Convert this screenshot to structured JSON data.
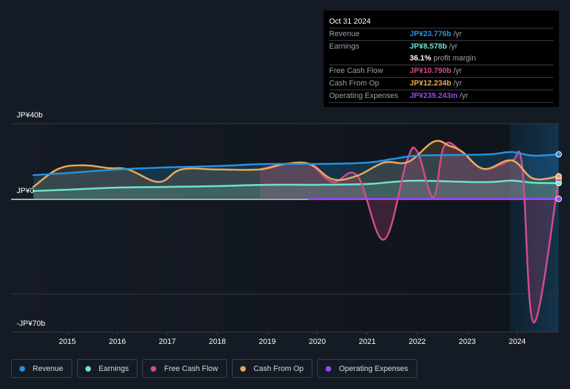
{
  "chart_data": {
    "type": "line",
    "title": "",
    "xlabel": "",
    "ylabel": "",
    "x_range": [
      2014.32,
      2024.83
    ],
    "ylim": [
      -70,
      40
    ],
    "y_unit": "JP¥ billions",
    "y_tick_labels": [
      {
        "value": 40,
        "label": "JP¥40b"
      },
      {
        "value": 0,
        "label": "JP¥0"
      },
      {
        "value": -70,
        "label": "-JP¥70b"
      }
    ],
    "y_gridlines": [
      40,
      0,
      -50
    ],
    "x_ticks": [
      2015,
      2016,
      2017,
      2018,
      2019,
      2020,
      2021,
      2022,
      2023,
      2024
    ],
    "x_tick_labels": [
      "2015",
      "2016",
      "2017",
      "2018",
      "2019",
      "2020",
      "2021",
      "2022",
      "2023",
      "2024"
    ],
    "highlight_range": [
      2023.85,
      2024.83
    ],
    "legend_position": "bottom-left",
    "series": [
      {
        "name": "Revenue",
        "color": "#2394df",
        "x": [
          2014.32,
          2015.0,
          2016.0,
          2017.0,
          2018.0,
          2019.0,
          2020.0,
          2021.0,
          2021.5,
          2022.0,
          2023.0,
          2023.5,
          2023.9,
          2024.32,
          2024.83
        ],
        "y": [
          12.8,
          13.9,
          15.8,
          16.9,
          17.6,
          18.7,
          18.7,
          19.4,
          21.3,
          23.1,
          23.5,
          23.9,
          25.0,
          23.1,
          23.8
        ]
      },
      {
        "name": "Earnings",
        "color": "#6ce5c8",
        "x": [
          2014.32,
          2015.0,
          2016.0,
          2017.0,
          2018.0,
          2019.0,
          2020.0,
          2021.0,
          2021.5,
          2022.0,
          2023.0,
          2023.5,
          2023.9,
          2024.32,
          2024.83
        ],
        "y": [
          4.4,
          5.1,
          6.2,
          6.6,
          7.0,
          7.7,
          7.7,
          8.1,
          9.2,
          9.9,
          9.2,
          9.2,
          9.9,
          8.8,
          8.6
        ]
      },
      {
        "name": "Free Cash Flow",
        "color": "#d04d8b",
        "x": [
          2018.85,
          2019.35,
          2019.85,
          2020.31,
          2020.8,
          2021.33,
          2021.79,
          2022.0,
          2022.32,
          2022.54,
          2022.89,
          2023.33,
          2023.89,
          2024.1,
          2024.33,
          2024.83
        ],
        "y": [
          15.8,
          18.7,
          18.3,
          9.2,
          12.5,
          -21.3,
          20.2,
          25.3,
          1.1,
          28.3,
          25.3,
          16.1,
          20.6,
          17.5,
          -65.0,
          10.79
        ]
      },
      {
        "name": "Cash From Op",
        "color": "#e8a95a",
        "x": [
          2014.32,
          2014.82,
          2015.32,
          2015.83,
          2016.22,
          2016.83,
          2017.28,
          2018.0,
          2018.85,
          2019.35,
          2019.85,
          2020.31,
          2020.8,
          2021.33,
          2021.82,
          2022.33,
          2022.64,
          2022.89,
          2023.33,
          2023.89,
          2024.32,
          2024.83
        ],
        "y": [
          6.6,
          16.1,
          18.0,
          16.5,
          15.8,
          9.2,
          15.8,
          15.8,
          15.8,
          18.7,
          18.7,
          10.6,
          12.5,
          19.4,
          19.8,
          30.5,
          28.3,
          25.3,
          16.1,
          20.6,
          11.0,
          12.234
        ]
      },
      {
        "name": "Operating Expenses",
        "color": "#9b46e8",
        "x": [
          2019.83,
          2020.5,
          2021.5,
          2022.5,
          2023.5,
          2024.83
        ],
        "y": [
          0.24,
          0.24,
          0.24,
          0.24,
          0.24,
          0.239
        ]
      }
    ]
  },
  "tooltip": {
    "date": "Oct 31 2024",
    "rows": [
      {
        "label": "Revenue",
        "value": "JP¥23.776b",
        "unit": "/yr",
        "color": "#2394df"
      },
      {
        "label": "Earnings",
        "value": "JP¥8.578b",
        "unit": "/yr",
        "color": "#6ce5c8"
      },
      {
        "label": "",
        "value": "36.1%",
        "unit": "profit margin",
        "color": "#ffffff"
      },
      {
        "label": "Free Cash Flow",
        "value": "JP¥10.790b",
        "unit": "/yr",
        "color": "#d04d8b"
      },
      {
        "label": "Cash From Op",
        "value": "JP¥12.234b",
        "unit": "/yr",
        "color": "#e8a95a"
      },
      {
        "label": "Operating Expenses",
        "value": "JP¥239.243m",
        "unit": "/yr",
        "color": "#9b46e8"
      }
    ]
  },
  "legend": [
    {
      "label": "Revenue",
      "color": "#2394df"
    },
    {
      "label": "Earnings",
      "color": "#6ce5c8"
    },
    {
      "label": "Free Cash Flow",
      "color": "#d04d8b"
    },
    {
      "label": "Cash From Op",
      "color": "#e8a95a"
    },
    {
      "label": "Operating Expenses",
      "color": "#9b46e8"
    }
  ]
}
